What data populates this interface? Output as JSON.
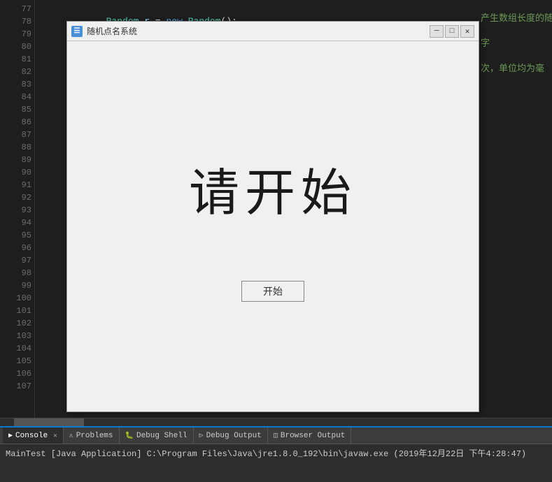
{
  "window": {
    "title": "随机点名系统",
    "title_icon": "☰",
    "minimize_label": "─",
    "maximize_label": "□",
    "close_label": "✕"
  },
  "main_text": "请开始",
  "start_button_label": "开始",
  "code": {
    "lines": [
      {
        "num": "77",
        "content": "    Random r = new Random();",
        "dot": false
      },
      {
        "num": "78",
        "content": "",
        "dot": false
      },
      {
        "num": "79",
        "content": "",
        "dot": false
      },
      {
        "num": "80",
        "content": "",
        "dot": false
      },
      {
        "num": "81",
        "content": "",
        "dot": false
      },
      {
        "num": "82",
        "content": "",
        "dot": false
      },
      {
        "num": "83",
        "content": "",
        "dot": false
      },
      {
        "num": "84",
        "content": "",
        "dot": false
      },
      {
        "num": "85",
        "content": "",
        "dot": false
      },
      {
        "num": "86",
        "content": "",
        "dot": false
      },
      {
        "num": "87",
        "content": "",
        "dot": false
      },
      {
        "num": "88",
        "content": "",
        "dot": false
      },
      {
        "num": "89",
        "content": "",
        "dot": false
      },
      {
        "num": "90",
        "content": "",
        "dot": false
      },
      {
        "num": "91",
        "content": "",
        "dot": false
      },
      {
        "num": "92",
        "content": "",
        "dot": true
      },
      {
        "num": "93",
        "content": "",
        "dot": false
      },
      {
        "num": "94",
        "content": "",
        "dot": false
      },
      {
        "num": "95",
        "content": "",
        "dot": false
      },
      {
        "num": "96",
        "content": "",
        "dot": false
      },
      {
        "num": "97",
        "content": "",
        "dot": false
      },
      {
        "num": "98",
        "content": "",
        "dot": true
      },
      {
        "num": "99",
        "content": "",
        "dot": false
      },
      {
        "num": "100",
        "content": "",
        "dot": false
      },
      {
        "num": "101",
        "content": "",
        "dot": false
      },
      {
        "num": "102",
        "content": "",
        "dot": false
      },
      {
        "num": "103",
        "content": "",
        "dot": false
      },
      {
        "num": "104",
        "content": "",
        "dot": true
      },
      {
        "num": "105",
        "content": "",
        "dot": false
      },
      {
        "num": "106",
        "content": "",
        "dot": false
      },
      {
        "num": "107",
        "content": "",
        "dot": false
      }
    ],
    "right_comments": [
      "产生数组长度的随",
      "字",
      "次，单位均为毫"
    ]
  },
  "bottom_panel": {
    "tabs": [
      {
        "id": "console",
        "label": "Console",
        "icon": "▶",
        "active": true,
        "closeable": true
      },
      {
        "id": "problems",
        "label": "Problems",
        "icon": "⚠",
        "active": false,
        "closeable": false
      },
      {
        "id": "debug-shell",
        "label": "Debug Shell",
        "icon": "🐛",
        "active": false,
        "closeable": false
      },
      {
        "id": "debug-output",
        "label": "Debug Output",
        "icon": "▷",
        "active": false,
        "closeable": false
      },
      {
        "id": "browser-output",
        "label": "Browser Output",
        "icon": "◫",
        "active": false,
        "closeable": false
      }
    ],
    "status_text": "MainTest [Java Application] C:\\Program Files\\Java\\jre1.8.0_192\\bin\\javaw.exe (2019年12月22日 下午4:28:47)"
  }
}
